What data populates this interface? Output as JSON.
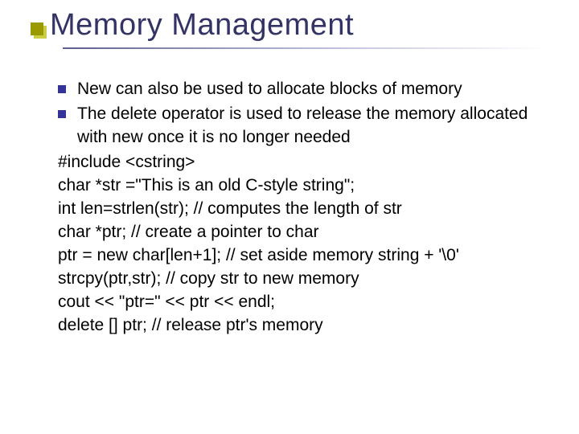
{
  "title": "Memory Management",
  "bullets": [
    "New can also be used to allocate blocks of memory",
    "The delete operator is used to release the memory allocated with new once it is no longer needed"
  ],
  "code": [
    "#include <cstring>",
    "char *str =\"This is an old C-style string\";",
    "int len=strlen(str); // computes the length of str",
    "char *ptr;  // create a pointer to char",
    "ptr = new char[len+1];  // set aside memory string + '\\0'",
    "strcpy(ptr,str); // copy str to new memory",
    "cout << \"ptr=\" << ptr << endl;",
    "delete [] ptr;  // release ptr's memory"
  ]
}
